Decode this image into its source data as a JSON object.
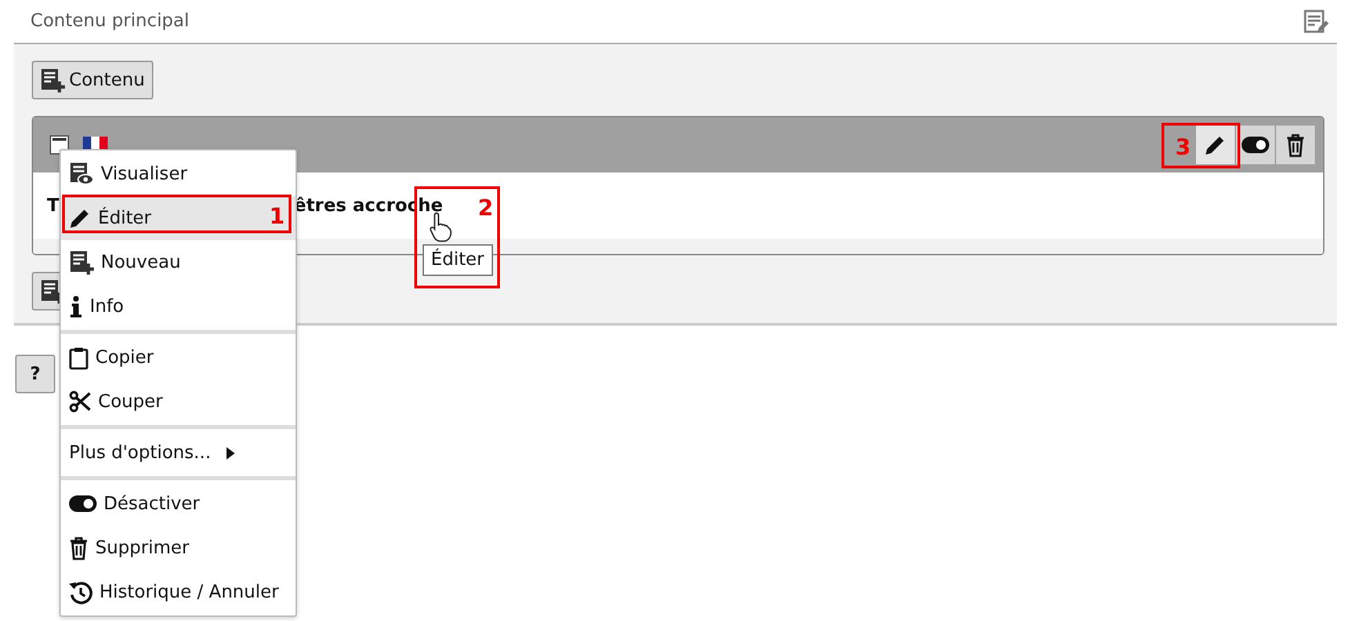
{
  "header": {
    "title": "Contenu principal"
  },
  "toolbar": {
    "add_button": "Contenu"
  },
  "record": {
    "title_start": "T",
    "title_end": "êtres accroche",
    "actions": [
      {
        "kind": "edit",
        "hovered": true
      },
      {
        "kind": "toggle",
        "hovered": false
      },
      {
        "kind": "delete",
        "hovered": false
      }
    ]
  },
  "help_button": "?",
  "context_menu": {
    "groups": [
      [
        {
          "kind": "view",
          "label": "Visualiser",
          "selected": false
        },
        {
          "kind": "edit",
          "label": "Éditer",
          "selected": true
        },
        {
          "kind": "new",
          "label": "Nouveau",
          "selected": false
        },
        {
          "kind": "info",
          "label": "Info",
          "selected": false
        }
      ],
      [
        {
          "kind": "copy",
          "label": "Copier",
          "selected": false
        },
        {
          "kind": "cut",
          "label": "Couper",
          "selected": false
        }
      ],
      [
        {
          "kind": "more",
          "label": "Plus d'options...",
          "selected": false
        }
      ],
      [
        {
          "kind": "toggle",
          "label": "Désactiver",
          "selected": false
        },
        {
          "kind": "delete",
          "label": "Supprimer",
          "selected": false
        },
        {
          "kind": "history",
          "label": "Historique / Annuler",
          "selected": false
        }
      ]
    ]
  },
  "tooltip": "Éditer",
  "annotations": [
    {
      "number": "1"
    },
    {
      "number": "2"
    },
    {
      "number": "3"
    }
  ]
}
